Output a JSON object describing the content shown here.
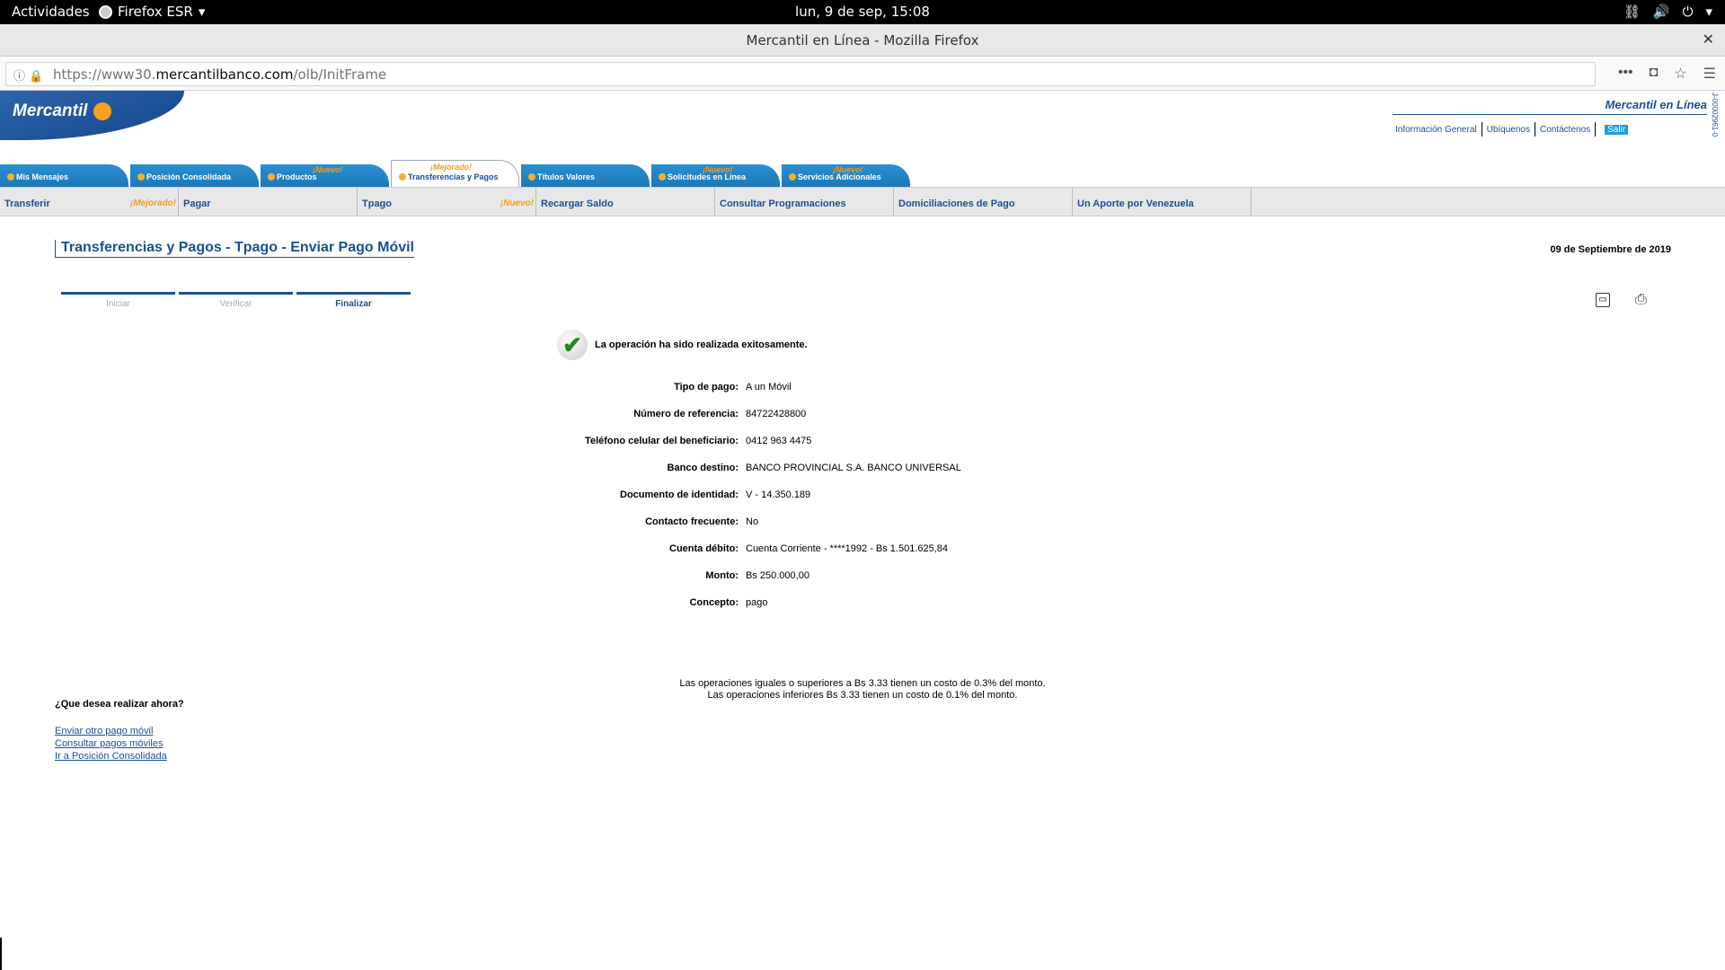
{
  "gnome": {
    "activities": "Actividades",
    "app": "Firefox ESR",
    "clock": "lun,  9 de sep, 15:08"
  },
  "window": {
    "title": "Mercantil en Línea - Mozilla Firefox"
  },
  "browser": {
    "url_prefix": "https://www30.",
    "url_domain": "mercantilbanco.com",
    "url_path": "/olb/InitFrame"
  },
  "header": {
    "logo": "Mercantil",
    "brand": "Mercantil en Línea",
    "links": [
      "Información General",
      "Ubíquenos",
      "Contáctenos"
    ],
    "salir": "Salir",
    "vertical_code": "J-00002961-0"
  },
  "tabs": [
    {
      "label": "Mis Mensajes",
      "badge": ""
    },
    {
      "label": "Posición Consolidada",
      "badge": ""
    },
    {
      "label": "Productos",
      "badge": "¡Nuevo!"
    },
    {
      "label": "Transferencias y Pagos",
      "badge": "¡Mejorado!"
    },
    {
      "label": "Títulos Valores",
      "badge": ""
    },
    {
      "label": "Solicitudes en Línea",
      "badge": "¡Nuevo!"
    },
    {
      "label": "Servicios Adicionales",
      "badge": "¡Nuevo!"
    }
  ],
  "subnav": [
    {
      "label": "Transferir",
      "badge": "¡Mejorado!"
    },
    {
      "label": "Pagar",
      "badge": ""
    },
    {
      "label": "Tpago",
      "badge": "¡Nuevo!"
    },
    {
      "label": "Recargar Saldo",
      "badge": ""
    },
    {
      "label": "Consultar Programaciones",
      "badge": ""
    },
    {
      "label": "Domiciliaciones de Pago",
      "badge": ""
    },
    {
      "label": "Un Aporte por Venezuela",
      "badge": ""
    }
  ],
  "main": {
    "title": "Transferencias y Pagos - Tpago - Enviar Pago Móvil",
    "date": "09 de Septiembre de 2019",
    "steps": [
      "Iniciar",
      "Verificar",
      "Finalizar"
    ],
    "success": "La operación ha sido realizada exitosamente.",
    "details": [
      {
        "label": "Tipo de pago:",
        "value": "A un Móvil"
      },
      {
        "label": "Número de referencia:",
        "value": "84722428800"
      },
      {
        "label": "Teléfono celular del beneficiario:",
        "value": "0412 963 4475"
      },
      {
        "label": "Banco destino:",
        "value": "BANCO PROVINCIAL S.A. BANCO UNIVERSAL"
      },
      {
        "label": "Documento de identidad:",
        "value": "V - 14.350.189"
      },
      {
        "label": "Contacto frecuente:",
        "value": "No"
      },
      {
        "label": "Cuenta débito:",
        "value": "Cuenta Corriente - ****1992 - Bs 1.501.625,84"
      },
      {
        "label": "Monto:",
        "value": "Bs 250.000,00"
      },
      {
        "label": "Concepto:",
        "value": "pago"
      }
    ],
    "note1": "Las operaciones iguales o superiores a Bs 3.33 tienen un costo de 0.3% del monto.",
    "note2": "Las operaciones inferiores Bs 3.33 tienen un costo de 0.1% del monto.",
    "next_title": "¿Que desea realizar ahora?",
    "next_links": [
      "Enviar otro pago móvil",
      "Consultar pagos móviles",
      "Ir a Posición Consolidada"
    ]
  }
}
